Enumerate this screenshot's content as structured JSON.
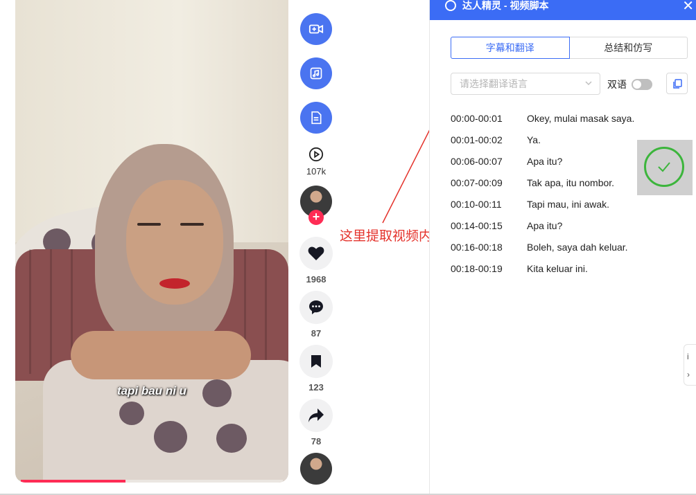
{
  "video": {
    "caption": "tapi bau ni u",
    "progress_fraction": 0.4
  },
  "rail": {
    "buttons": [
      {
        "name": "video-add-icon"
      },
      {
        "name": "music-icon"
      },
      {
        "name": "document-icon"
      }
    ],
    "play_count": "107k",
    "likes": "1968",
    "comments": "87",
    "saves": "123",
    "shares": "78",
    "follow_symbol": "+"
  },
  "annotation": {
    "text": "这里提取视频内容",
    "color": "#e4322b"
  },
  "panel": {
    "title": "达人精灵 - 视频脚本",
    "close_symbol": "✕",
    "header_color": "#3b6cf5",
    "tabs": [
      {
        "label": "字幕和翻译",
        "active": true
      },
      {
        "label": "总结和仿写",
        "active": false
      }
    ],
    "language_placeholder": "请选择翻译语言",
    "bilingual_label": "双语",
    "bilingual_on": false,
    "subtitles": [
      {
        "time": "00:00-00:01",
        "text": "Okey, mulai masak saya."
      },
      {
        "time": "00:01-00:02",
        "text": "Ya."
      },
      {
        "time": "00:06-00:07",
        "text": "Apa itu?"
      },
      {
        "time": "00:07-00:09",
        "text": "Tak apa, itu nombor."
      },
      {
        "time": "00:10-00:11",
        "text": "Tapi mau, ini awak."
      },
      {
        "time": "00:14-00:15",
        "text": "Apa itu?"
      },
      {
        "time": "00:16-00:18",
        "text": "Boleh, saya dah keluar."
      },
      {
        "time": "00:18-00:19",
        "text": "Kita keluar ini."
      }
    ]
  },
  "edge_tab": {
    "top_char": "i",
    "bottom_char": "›"
  }
}
